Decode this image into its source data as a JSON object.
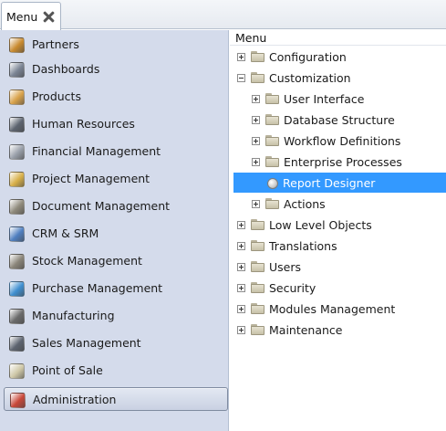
{
  "tab": {
    "label": "Menu"
  },
  "menu": {
    "items": [
      {
        "label": "Partners",
        "icon": "partners-icon",
        "color": "#c98a2f"
      },
      {
        "label": "Dashboards",
        "icon": "dashboards-icon",
        "color": "#7b8494"
      },
      {
        "label": "Products",
        "icon": "products-icon",
        "color": "#d9a24b"
      },
      {
        "label": "Human Resources",
        "icon": "calculator-icon",
        "color": "#5d6470"
      },
      {
        "label": "Financial Management",
        "icon": "financial-icon",
        "color": "#9aa0aa"
      },
      {
        "label": "Project Management",
        "icon": "clock-icon",
        "color": "#d8b04a"
      },
      {
        "label": "Document Management",
        "icon": "document-icon",
        "color": "#8f8a7c"
      },
      {
        "label": "CRM & SRM",
        "icon": "crm-icon",
        "color": "#4f7fc0"
      },
      {
        "label": "Stock Management",
        "icon": "stock-icon",
        "color": "#8a857a"
      },
      {
        "label": "Purchase Management",
        "icon": "purchase-icon",
        "color": "#3f8fd0"
      },
      {
        "label": "Manufacturing",
        "icon": "manufacturing-icon",
        "color": "#6b6b6b"
      },
      {
        "label": "Sales Management",
        "icon": "sales-icon",
        "color": "#5d6470"
      },
      {
        "label": "Point of Sale",
        "icon": "folder-icon",
        "color": "#cfc8a8"
      },
      {
        "label": "Administration",
        "icon": "administration-icon",
        "color": "#c9483a"
      }
    ]
  },
  "tree": {
    "header": "Menu",
    "nodes": [
      {
        "label": "Configuration",
        "level": 0,
        "expander": "plus",
        "icon": "folder-icon"
      },
      {
        "label": "Customization",
        "level": 0,
        "expander": "minus",
        "icon": "folder-icon"
      },
      {
        "label": "User Interface",
        "level": 1,
        "expander": "plus",
        "icon": "folder-icon"
      },
      {
        "label": "Database Structure",
        "level": 1,
        "expander": "plus",
        "icon": "folder-icon"
      },
      {
        "label": "Workflow Definitions",
        "level": 1,
        "expander": "plus",
        "icon": "folder-icon"
      },
      {
        "label": "Enterprise Processes",
        "level": 1,
        "expander": "plus",
        "icon": "folder-icon"
      },
      {
        "label": "Report Designer",
        "level": 1,
        "expander": "none",
        "icon": "report-designer-icon",
        "selected": true
      },
      {
        "label": "Actions",
        "level": 1,
        "expander": "plus",
        "icon": "folder-icon"
      },
      {
        "label": "Low Level Objects",
        "level": 0,
        "expander": "plus",
        "icon": "folder-icon"
      },
      {
        "label": "Translations",
        "level": 0,
        "expander": "plus",
        "icon": "folder-icon"
      },
      {
        "label": "Users",
        "level": 0,
        "expander": "plus",
        "icon": "folder-icon"
      },
      {
        "label": "Security",
        "level": 0,
        "expander": "plus",
        "icon": "folder-icon"
      },
      {
        "label": "Modules Management",
        "level": 0,
        "expander": "plus",
        "icon": "folder-icon"
      },
      {
        "label": "Maintenance",
        "level": 0,
        "expander": "plus",
        "icon": "folder-icon"
      }
    ]
  },
  "colors": {
    "selection": "#3399ff",
    "panel": "#d4dbeb"
  }
}
